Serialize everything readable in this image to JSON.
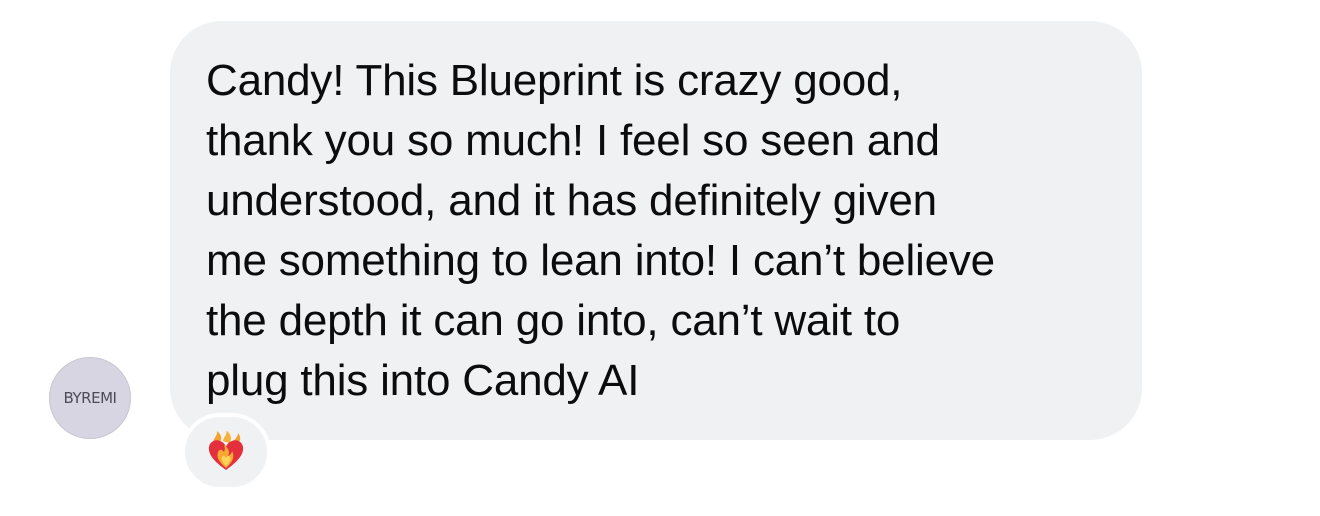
{
  "avatar": {
    "label": "BYREMI"
  },
  "message": {
    "text": "Candy! This Blueprint is crazy good,\nthank you so much! I feel so seen and\nunderstood, and it has definitely given\nme something to lean into! I can’t believe\nthe depth it can go into, can’t wait to\nplug this into Candy AI"
  },
  "reaction": {
    "icon": "heart-on-fire-icon"
  },
  "colors": {
    "bubble": "#f0f1f3",
    "avatar_bg": "#d7d5e1",
    "text": "#0c0c0e",
    "heart": "#e42f3d",
    "fire": "#f4a22c"
  }
}
